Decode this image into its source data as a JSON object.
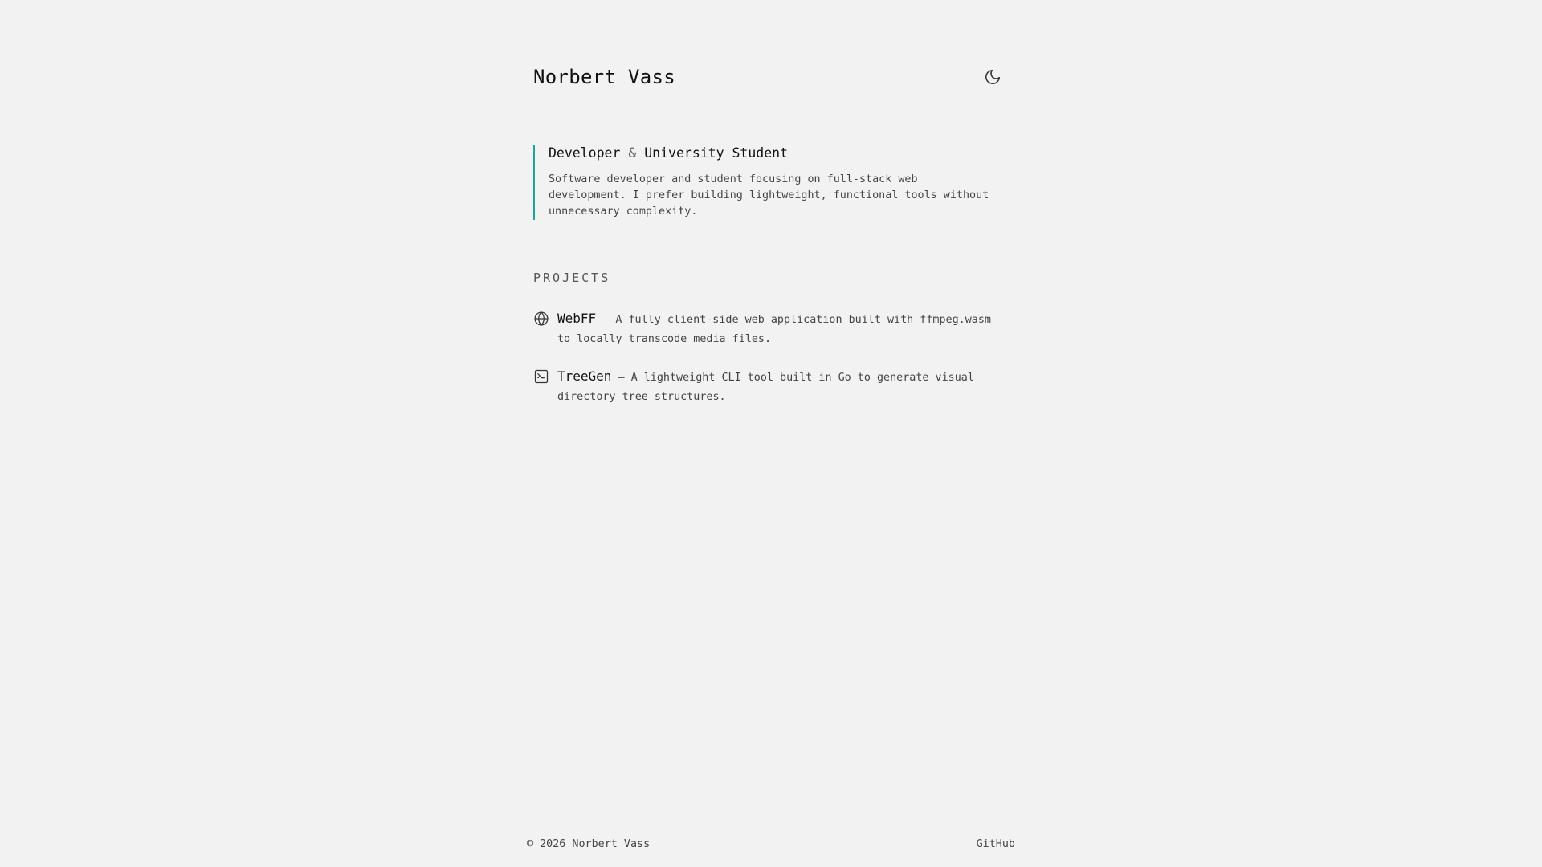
{
  "header": {
    "site_title": "Norbert Vass",
    "theme_toggle_icon": "moon-icon"
  },
  "intro": {
    "heading_part1": "Developer",
    "heading_amp": "&",
    "heading_part2": "University Student",
    "text": "Software developer and student focusing on full-stack web development. I prefer building lightweight, functional tools without unnecessary complexity.",
    "accent_color": "#1aa79a"
  },
  "projects": {
    "label": "PROJECTS",
    "items": [
      {
        "icon": "globe-icon",
        "name": "WebFF",
        "separator": "—",
        "description": "A fully client-side web application built with ffmpeg.wasm to locally transcode media files."
      },
      {
        "icon": "terminal-icon",
        "name": "TreeGen",
        "separator": "—",
        "description": "A lightweight CLI tool built in Go to generate visual directory tree structures."
      }
    ]
  },
  "footer": {
    "copyright": "© 2026 Norbert Vass",
    "github_label": "GitHub"
  }
}
